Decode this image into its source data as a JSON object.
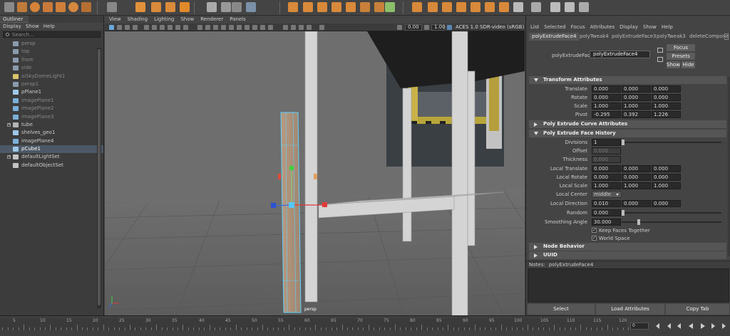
{
  "outliner": {
    "tab": "Outliner",
    "menu": [
      "Display",
      "Show",
      "Help"
    ],
    "search_placeholder": "Search...",
    "items": [
      {
        "label": "persp",
        "dim": true,
        "icon": "camera"
      },
      {
        "label": "top",
        "dim": true,
        "icon": "camera"
      },
      {
        "label": "front",
        "dim": true,
        "icon": "camera"
      },
      {
        "label": "side",
        "dim": true,
        "icon": "camera"
      },
      {
        "label": "aiSkyDomeLight1",
        "dim": true,
        "icon": "light"
      },
      {
        "label": "persp1",
        "dim": true,
        "icon": "camera"
      },
      {
        "label": "pPlane1",
        "dim": false,
        "icon": "mesh"
      },
      {
        "label": "imagePlane1",
        "dim": true,
        "icon": "image"
      },
      {
        "label": "imagePlane2",
        "dim": true,
        "icon": "image"
      },
      {
        "label": "imagePlane3",
        "dim": true,
        "icon": "image"
      },
      {
        "label": "tube",
        "dim": false,
        "icon": "group",
        "expand": true
      },
      {
        "label": "shelves_geo1",
        "dim": false,
        "icon": "mesh"
      },
      {
        "label": "imagePlane4",
        "dim": false,
        "icon": "image"
      },
      {
        "label": "pCube1",
        "dim": false,
        "icon": "mesh",
        "selected": true
      },
      {
        "label": "defaultLightSet",
        "dim": false,
        "icon": "set",
        "expand": true
      },
      {
        "label": "defaultObjectSet",
        "dim": false,
        "icon": "set"
      }
    ]
  },
  "viewport": {
    "menu": [
      "View",
      "Shading",
      "Lighting",
      "Show",
      "Renderer",
      "Panels"
    ],
    "exposure": "0.00",
    "gamma": "1.00",
    "color_space": "ACES 1.0 SDR-video (sRGB)",
    "camera": "persp"
  },
  "attribute_editor": {
    "menu": [
      "List",
      "Selected",
      "Focus",
      "Attributes",
      "Display",
      "Show",
      "Help"
    ],
    "tabs": [
      "polyExtrudeFace4",
      "polyTweak4",
      "polyExtrudeFace3",
      "polyTweak3",
      "deleteCompone"
    ],
    "node_label": "polyExtrudeFace:",
    "node_name": "polyExtrudeFace4",
    "focus_btn": "Focus",
    "presets_btn": "Presets",
    "show_btn": "Show",
    "hide_btn": "Hide",
    "sections": {
      "transform": "Transform Attributes",
      "curve": "Poly Extrude Curve Attributes",
      "history": "Poly Extrude Face History",
      "node_behavior": "Node Behavior",
      "uuid": "UUID"
    },
    "transform": [
      {
        "label": "Translate",
        "values": [
          "0.000",
          "0.000",
          "0.000"
        ]
      },
      {
        "label": "Rotate",
        "values": [
          "0.000",
          "0.000",
          "0.000"
        ]
      },
      {
        "label": "Scale",
        "values": [
          "1.000",
          "1.000",
          "1.000"
        ]
      },
      {
        "label": "Pivot",
        "values": [
          "-0.295",
          "0.392",
          "1.226"
        ]
      }
    ],
    "history": {
      "divisions_label": "Divisions",
      "divisions": "1",
      "offset_label": "Offset",
      "offset": "0.000",
      "thickness_label": "Thickness",
      "thickness": "0.000",
      "local_translate_label": "Local Translate",
      "local_translate": [
        "0.000",
        "0.000",
        "0.000"
      ],
      "local_rotate_label": "Local Rotate",
      "local_rotate": [
        "0.000",
        "0.000",
        "0.000"
      ],
      "local_scale_label": "Local Scale",
      "local_scale": [
        "1.000",
        "1.000",
        "1.000"
      ],
      "local_center_label": "Local Center",
      "local_center": "middle",
      "local_direction_label": "Local Direction",
      "local_direction": [
        "0.010",
        "0.000",
        "0.000"
      ],
      "random_label": "Random",
      "random": "0.000",
      "smoothing_angle_label": "Smoothing Angle",
      "smoothing_angle": "30.000",
      "keep_faces_together": "Keep Faces Together",
      "world_space": "World Space"
    },
    "notes_label": "Notes:",
    "notes_node": "polyExtrudeFace4",
    "buttons": [
      "Select",
      "Load Attributes",
      "Copy Tab"
    ]
  },
  "timeline": {
    "ticks": [
      "5",
      "10",
      "15",
      "20",
      "25",
      "30",
      "35",
      "40",
      "45",
      "50",
      "55",
      "60",
      "65",
      "70",
      "75",
      "80",
      "85",
      "90",
      "95",
      "100",
      "105",
      "110",
      "115",
      "120"
    ],
    "current_frame": "0"
  }
}
